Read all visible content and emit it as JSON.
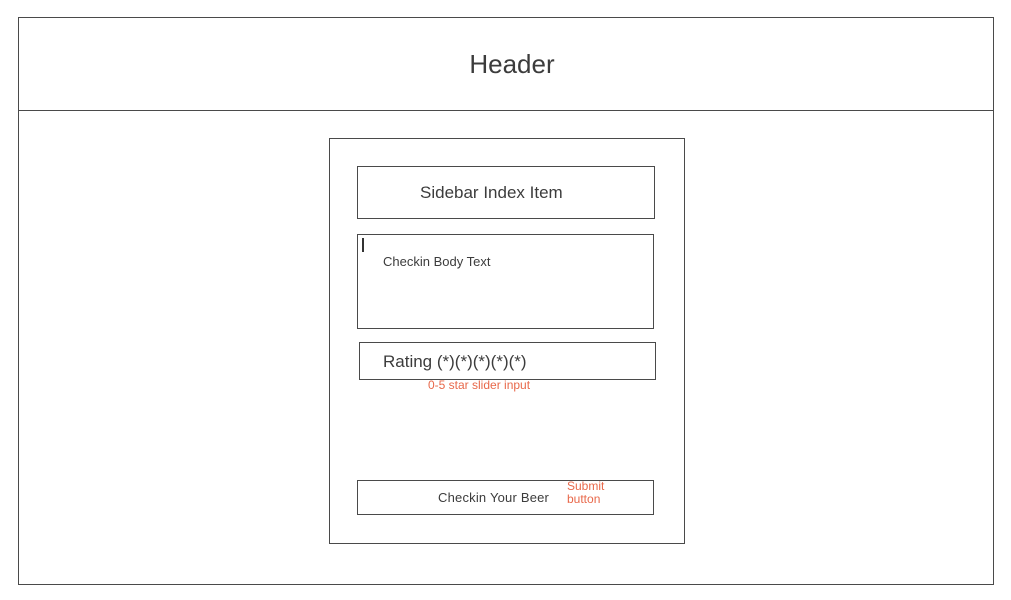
{
  "header": {
    "title": "Header"
  },
  "checkin_form": {
    "sidebar_index_item": "Sidebar Index Item",
    "body_placeholder": "Checkin Body Text",
    "rating_label": "Rating (*)(*)(*)(*)(*)",
    "rating_annotation": "0-5 star slider input",
    "submit_label": "Checkin Your Beer",
    "submit_annotation_line1": "Submit",
    "submit_annotation_line2": "button"
  },
  "colors": {
    "border": "#4a4a4a",
    "text": "#3c3c3c",
    "annotation": "#e8684a"
  }
}
